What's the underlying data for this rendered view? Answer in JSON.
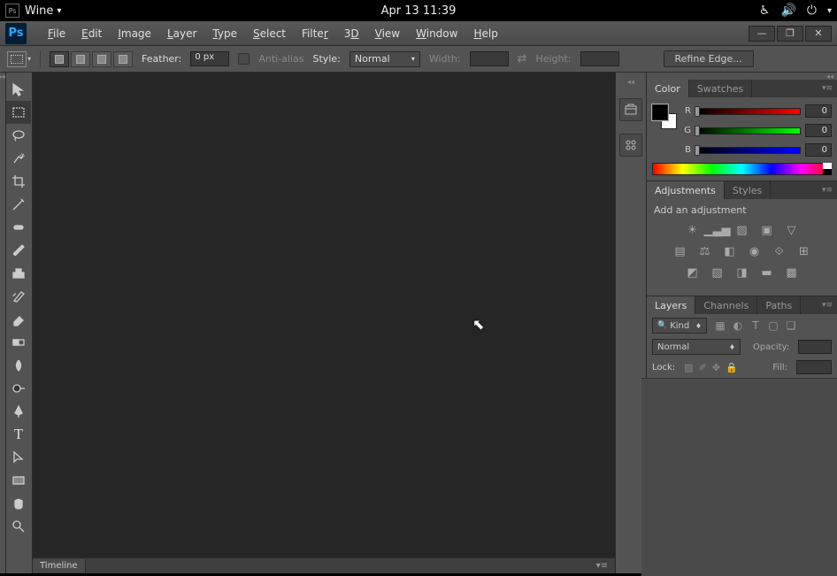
{
  "system": {
    "app_menu": "Wine",
    "clock": "Apr 13  11:39"
  },
  "menu": {
    "file": "File",
    "edit": "Edit",
    "image": "Image",
    "layer": "Layer",
    "type": "Type",
    "select": "Select",
    "filter": "Filter",
    "threeD": "3D",
    "view": "View",
    "window": "Window",
    "help": "Help"
  },
  "options": {
    "feather_label": "Feather:",
    "feather_value": "0 px",
    "antialias": "Anti-alias",
    "style_label": "Style:",
    "style_value": "Normal",
    "width_label": "Width:",
    "height_label": "Height:",
    "refine": "Refine Edge..."
  },
  "panels": {
    "color_tab": "Color",
    "swatches_tab": "Swatches",
    "r_label": "R",
    "g_label": "G",
    "b_label": "B",
    "r_val": "0",
    "g_val": "0",
    "b_val": "0",
    "adjustments_tab": "Adjustments",
    "styles_tab": "Styles",
    "adj_title": "Add an adjustment",
    "layers_tab": "Layers",
    "channels_tab": "Channels",
    "paths_tab": "Paths",
    "kind_label": "Kind",
    "blend_mode": "Normal",
    "opacity_label": "Opacity:",
    "lock_label": "Lock:",
    "fill_label": "Fill:"
  },
  "timeline": {
    "label": "Timeline"
  }
}
